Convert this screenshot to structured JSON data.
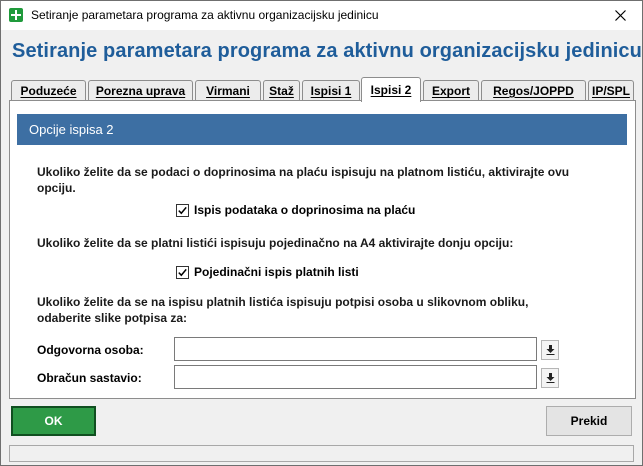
{
  "window": {
    "title": "Setiranje parametara programa za aktivnu organizacijsku jedinicu"
  },
  "heading": "Setiranje parametara programa za aktivnu organizacijsku jedinicu",
  "tabs": [
    {
      "label": "Poduzeće",
      "active": false
    },
    {
      "label": "Porezna uprava",
      "active": false
    },
    {
      "label": "Virmani",
      "active": false
    },
    {
      "label": "Staž",
      "active": false
    },
    {
      "label": "Ispisi 1",
      "active": false
    },
    {
      "label": "Ispisi 2",
      "active": true
    },
    {
      "label": "Export",
      "active": false
    },
    {
      "label": "Regos/JOPPD",
      "active": false
    },
    {
      "label": "IP/SPL",
      "active": false
    }
  ],
  "section": {
    "title": "Opcije ispisa 2"
  },
  "options": {
    "doprinosi_text": "Ukoliko želite da se podaci o doprinosima na plaću ispisuju na platnom listiću, aktivirajte ovu opciju.",
    "doprinosi_checkbox": {
      "label": "Ispis podataka o doprinosima na plaću",
      "checked": true
    },
    "pojedinacni_text": "Ukoliko želite da se platni listići ispisuju pojedinačno na A4 aktivirajte donju opciju:",
    "pojedinacni_checkbox": {
      "label": "Pojedinačni ispis platnih listi",
      "checked": true
    },
    "potpisi_text": "Ukoliko želite da se na ispisu platnih listića ispisuju potpisi osoba u slikovnom obliku, odaberite slike potpisa za:"
  },
  "fields": {
    "odgovorna": {
      "label": "Odgovorna osoba:",
      "value": ""
    },
    "obracun": {
      "label": "Obračun sastavio:",
      "value": ""
    }
  },
  "buttons": {
    "ok": "OK",
    "cancel": "Prekid"
  },
  "colors": {
    "heading": "#1f5d9a",
    "section_header": "#3d6fa3",
    "ok_button": "#2e9a47"
  }
}
